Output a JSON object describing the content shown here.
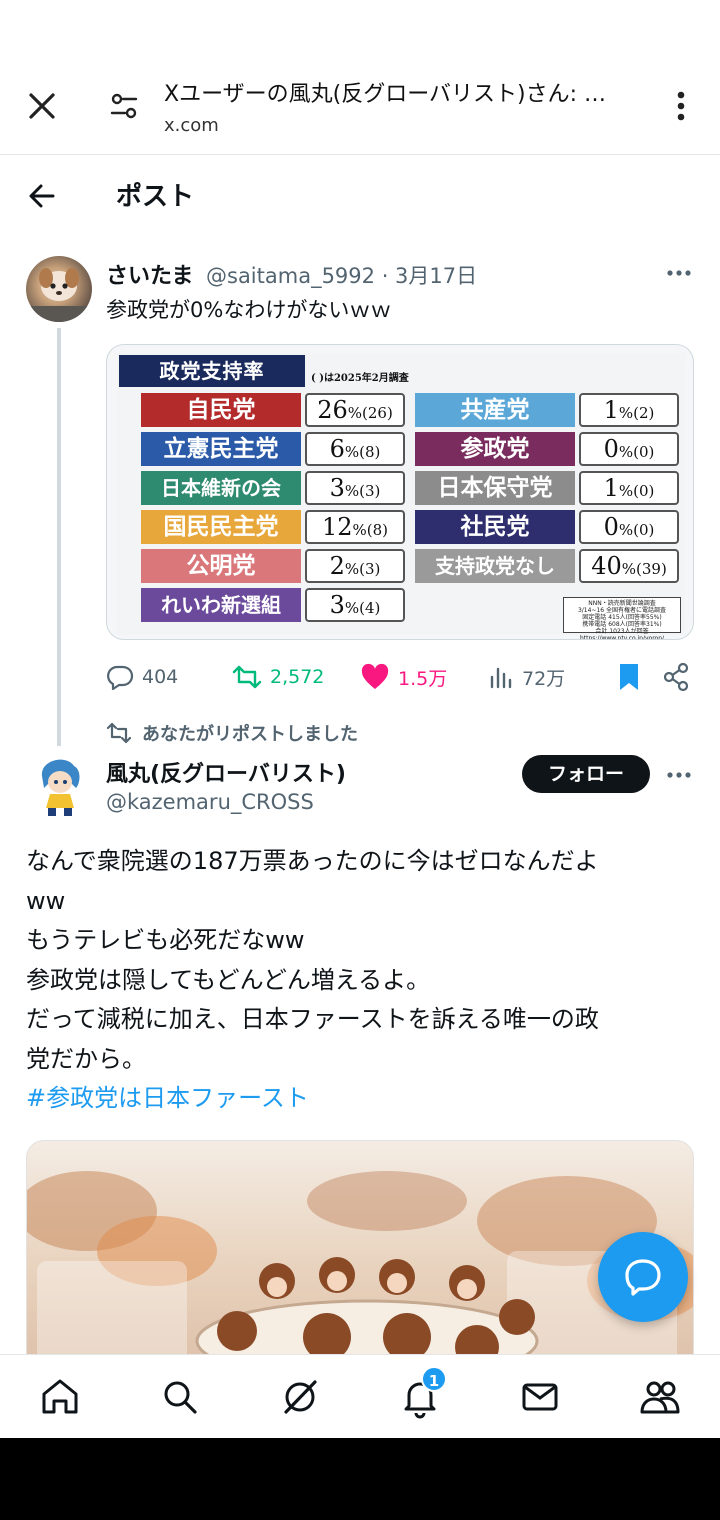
{
  "browser": {
    "title": "Xユーザーの風丸(反グローバリスト)さん: …",
    "domain": "x.com"
  },
  "header": {
    "title": "ポスト"
  },
  "tweet1": {
    "name": "さいたま",
    "handle": "@saitama_5992 · 3月17日",
    "text": "参政党が0%なわけがないｗｗ",
    "poll_image": {
      "title": "政党支持率",
      "note": "( )は2025年2月調査",
      "rows": [
        {
          "party": "自民党",
          "value": "26",
          "prev": "(26)",
          "color": "#b32b2b"
        },
        {
          "party": "立憲民主党",
          "value": "6",
          "prev": "(8)",
          "color": "#2b5aa8"
        },
        {
          "party": "日本維新の会",
          "value": "3",
          "prev": "(3)",
          "color": "#2f8b6f"
        },
        {
          "party": "国民民主党",
          "value": "12",
          "prev": "(8)",
          "color": "#e8a73a"
        },
        {
          "party": "公明党",
          "value": "2",
          "prev": "(3)",
          "color": "#d9777a"
        },
        {
          "party": "れいわ新選組",
          "value": "3",
          "prev": "(4)",
          "color": "#6b4a9c"
        },
        {
          "party": "共産党",
          "value": "1",
          "prev": "(2)",
          "color": "#5ba8d8"
        },
        {
          "party": "参政党",
          "value": "0",
          "prev": "(0)",
          "color": "#7a2c5e"
        },
        {
          "party": "日本保守党",
          "value": "1",
          "prev": "(0)",
          "color": "#8c8c8c"
        },
        {
          "party": "社民党",
          "value": "0",
          "prev": "(0)",
          "color": "#2e2e6e"
        },
        {
          "party": "支持政党なし",
          "value": "40",
          "prev": "(39)",
          "color": "#9a9a9a"
        }
      ],
      "unit": "%",
      "source_lines": [
        "NNN・読売新聞世論調査",
        "3/14~16 全国有権者に電話調査",
        "固定電話 415人(回答率55%)",
        "携帯電話 608人(回答率31%)",
        "合計 1023人が回答",
        "https://www.ntv.co.jp/yoron/"
      ]
    },
    "stats": {
      "replies": "404",
      "reposts": "2,572",
      "likes": "1.5万",
      "views": "72万"
    }
  },
  "repost_note": "あなたがリポストしました",
  "tweet2": {
    "name": "風丸(反グローバリスト)",
    "handle": "@kazemaru_CROSS",
    "follow_label": "フォロー",
    "lines": [
      "なんで衆院選の187万票あったのに今はゼロなんだよ",
      "ww",
      "もうテレビも必死だなww",
      "参政党は隠してもどんどん増えるよ。",
      "だって減税に加え、日本ファーストを訴える唯一の政",
      "党だから。"
    ],
    "hashtag": "#参政党は日本ファースト"
  },
  "nav": {
    "notifications_badge": "1"
  },
  "colors": {
    "accent": "#1d9bf0",
    "repost": "#00ba7c",
    "like": "#f91880"
  }
}
